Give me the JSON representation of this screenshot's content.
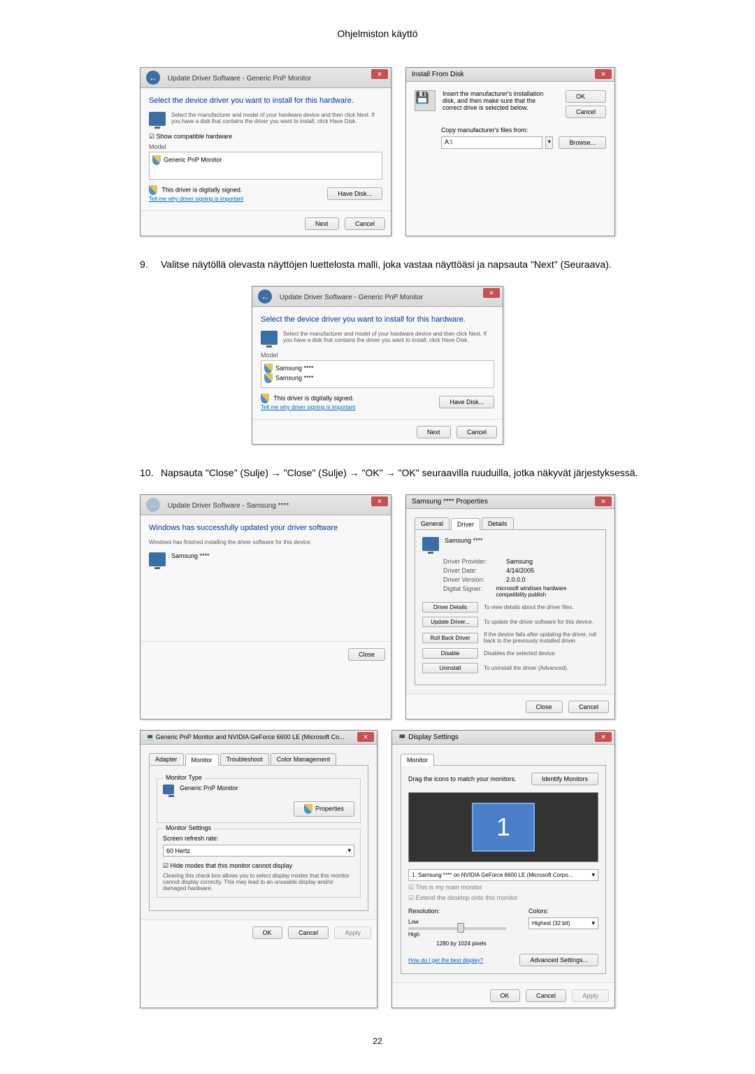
{
  "page_header": "Ohjelmiston käyttö",
  "page_number": "22",
  "step9": {
    "num": "9.",
    "text": "Valitse näytöllä olevasta näyttöjen luettelosta malli, joka vastaa näyttöäsi ja napsauta \"Next\" (Seuraava)."
  },
  "step10": {
    "num": "10.",
    "text": "Napsauta \"Close\" (Sulje) → \"Close\" (Sulje) → \"OK\" → \"OK\" seuraavilla ruuduilla, jotka näkyvät järjestyksessä."
  },
  "update_driver1": {
    "title": "Update Driver Software - Generic PnP Monitor",
    "heading": "Select the device driver you want to install for this hardware.",
    "infotext": "Select the manufacturer and model of your hardware device and then click Next. If you have a disk that contains the driver you want to install, click Have Disk.",
    "show_compat": "Show compatible hardware",
    "model_label": "Model",
    "model_item": "Generic PnP Monitor",
    "signed_text": "This driver is digitally signed.",
    "signing_link": "Tell me why driver signing is important",
    "have_disk_btn": "Have Disk...",
    "next_btn": "Next",
    "cancel_btn": "Cancel"
  },
  "install_disk": {
    "title": "Install From Disk",
    "text": "Insert the manufacturer's installation disk, and then make sure that the correct drive is selected below.",
    "ok_btn": "OK",
    "cancel_btn": "Cancel",
    "copy_label": "Copy manufacturer's files from:",
    "path": "A:\\",
    "browse_btn": "Browse..."
  },
  "update_driver2": {
    "title": "Update Driver Software - Generic PnP Monitor",
    "heading": "Select the device driver you want to install for this hardware.",
    "infotext": "Select the manufacturer and model of your hardware device and then click Next. If you have a disk that contains the driver you want to install, click Have Disk.",
    "model_label": "Model",
    "model_item1": "Samsung ****",
    "model_item2": "Samsung ****",
    "signed_text": "This driver is digitally signed.",
    "signing_link": "Tell me why driver signing is important",
    "have_disk_btn": "Have Disk...",
    "next_btn": "Next",
    "cancel_btn": "Cancel"
  },
  "close_dialog": {
    "title": "Update Driver Software - Samsung ****",
    "heading": "Windows has successfully updated your driver software",
    "subtext": "Windows has finished installing the driver software for this device:",
    "device": "Samsung ****",
    "close_btn": "Close"
  },
  "properties": {
    "title": "Samsung **** Properties",
    "tab_general": "General",
    "tab_driver": "Driver",
    "tab_details": "Details",
    "device_name": "Samsung ****",
    "provider_label": "Driver Provider:",
    "provider_val": "Samsung",
    "date_label": "Driver Date:",
    "date_val": "4/14/2005",
    "version_label": "Driver Version:",
    "version_val": "2.0.0.0",
    "signer_label": "Digital Signer:",
    "signer_val": "microsoft windows hardware compatibility publish",
    "details_btn": "Driver Details",
    "details_desc": "To view details about the driver files.",
    "update_btn": "Update Driver...",
    "update_desc": "To update the driver software for this device.",
    "rollback_btn": "Roll Back Driver",
    "rollback_desc": "If the device fails after updating the driver, roll back to the previously installed driver.",
    "disable_btn": "Disable",
    "disable_desc": "Disables the selected device.",
    "uninstall_btn": "Uninstall",
    "uninstall_desc": "To uninstall the driver (Advanced).",
    "close_btn": "Close",
    "cancel_btn": "Cancel"
  },
  "monitor_props": {
    "title": "Generic PnP Monitor and NVIDIA GeForce 6600 LE (Microsoft Co...",
    "tab_adapter": "Adapter",
    "tab_monitor": "Monitor",
    "tab_trouble": "Troubleshoot",
    "tab_color": "Color Management",
    "type_label": "Monitor Type",
    "type_val": "Generic PnP Monitor",
    "props_btn": "Properties",
    "settings_label": "Monitor Settings",
    "refresh_label": "Screen refresh rate:",
    "refresh_val": "60 Hertz",
    "hide_checkbox": "Hide modes that this monitor cannot display",
    "hide_text": "Clearing this check box allows you to select display modes that this monitor cannot display correctly. This may lead to an unusable display and/or damaged hardware.",
    "ok_btn": "OK",
    "cancel_btn": "Cancel",
    "apply_btn": "Apply"
  },
  "display_settings": {
    "title": "Display Settings",
    "tab_monitor": "Monitor",
    "drag_text": "Drag the icons to match your monitors.",
    "identify_btn": "Identify Monitors",
    "monitor_num": "1",
    "monitor_select": "1. Samsung **** on NVIDIA GeForce 6600 LE (Microsoft Corpo...",
    "main_checkbox": "This is my main monitor",
    "extend_checkbox": "Extend the desktop onto this monitor",
    "resolution_label": "Resolution:",
    "low_label": "Low",
    "high_label": "High",
    "resolution_val": "1280 by 1024 pixels",
    "colors_label": "Colors:",
    "colors_val": "Highest (32 bit)",
    "help_link": "How do I get the best display?",
    "advanced_btn": "Advanced Settings...",
    "ok_btn": "OK",
    "cancel_btn": "Cancel",
    "apply_btn": "Apply"
  }
}
